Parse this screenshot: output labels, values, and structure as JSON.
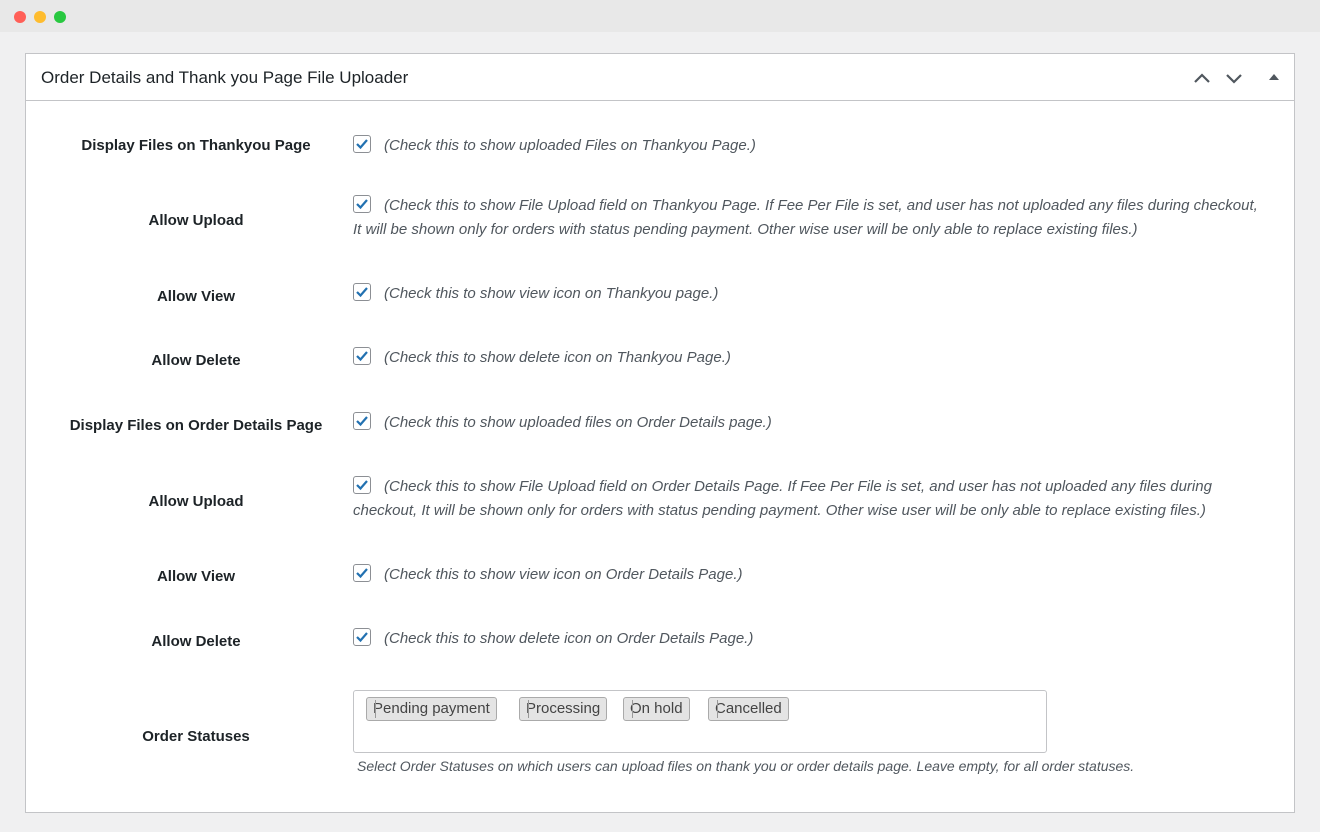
{
  "window": {
    "controls": [
      "close",
      "minimize",
      "maximize"
    ]
  },
  "panel": {
    "title": "Order Details and Thank you Page File Uploader",
    "header_buttons": [
      "move-up-icon",
      "move-down-icon",
      "toggle-panel-icon"
    ]
  },
  "settings": [
    {
      "label": "Display Files on Thankyou Page",
      "checked": true,
      "desc": "(Check this to show uploaded Files on Thankyou Page.)"
    },
    {
      "label": "Allow Upload",
      "checked": true,
      "desc": "(Check this to show File Upload field on Thankyou Page. If Fee Per File is set, and user has not uploaded any files during checkout, It will be shown only for orders with status pending payment. Other wise user will be only able to replace existing files.)"
    },
    {
      "label": "Allow View",
      "checked": true,
      "desc": "(Check this to show view icon on Thankyou page.)"
    },
    {
      "label": "Allow Delete",
      "checked": true,
      "desc": "(Check this to show delete icon on Thankyou Page.)"
    },
    {
      "label": "Display Files on Order Details Page",
      "checked": true,
      "desc": "(Check this to show uploaded files on Order Details page.)"
    },
    {
      "label": "Allow Upload",
      "checked": true,
      "desc": "(Check this to show File Upload field on Order Details Page. If Fee Per File is set, and user has not uploaded any files during checkout, It will be shown only for orders with status pending payment. Other wise user will be only able to replace existing files.)"
    },
    {
      "label": "Allow View",
      "checked": true,
      "desc": "(Check this to show view icon on Order Details Page.)"
    },
    {
      "label": "Allow Delete",
      "checked": true,
      "desc": "(Check this to show delete icon on Order Details Page.)"
    }
  ],
  "order_statuses": {
    "label": "Order Statuses",
    "selected": [
      "Pending payment",
      "Processing",
      "On hold",
      "Cancelled"
    ],
    "help": "Select Order Statuses on which users can upload files on thank you or order details page. Leave empty, for all order statuses."
  },
  "colors": {
    "checkmark": "#2271b1",
    "border": "#c3c4c7"
  }
}
